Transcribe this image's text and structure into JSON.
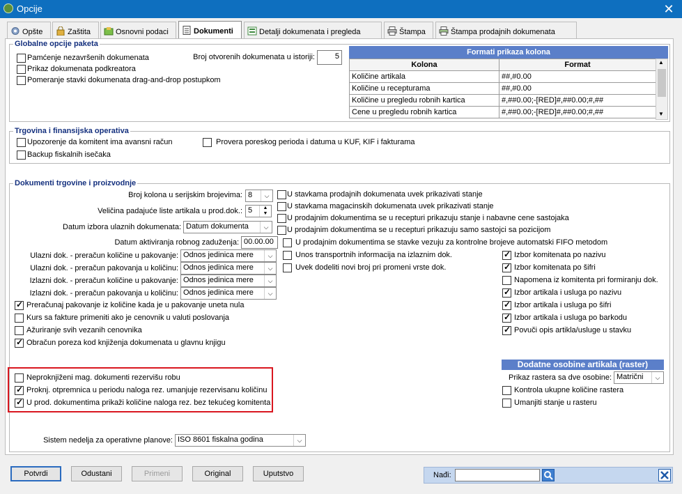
{
  "window": {
    "title": "Opcije",
    "close": "✕"
  },
  "tabs": [
    {
      "label": "Opšte"
    },
    {
      "label": "Zaštita"
    },
    {
      "label": "Osnovni podaci"
    },
    {
      "label": "Dokumenti"
    },
    {
      "label": "Detalji dokumenata i pregleda"
    },
    {
      "label": "Štampa"
    },
    {
      "label": "Štampa prodajnih dokumenata"
    }
  ],
  "global": {
    "title": "Globalne opcije paketa",
    "checks": [
      {
        "label": "Pamćenje nezavršenih dokumenata",
        "checked": false
      },
      {
        "label": "Prikaz dokumenata podkreatora",
        "checked": false
      },
      {
        "label": "Pomeranje stavki dokumenata drag-and-drop postupkom",
        "checked": false
      }
    ],
    "history_label": "Broj otvorenih dokumenata u istoriji:",
    "history_value": "5"
  },
  "formats": {
    "title": "Formati prikaza kolona",
    "headers": [
      "Kolona",
      "Format"
    ],
    "rows": [
      [
        "Količine artikala",
        "##,#0.00"
      ],
      [
        "Količine u recepturama",
        "##,#0.00"
      ],
      [
        "Količine u pregledu robnih kartica",
        "#,##0.00;-[RED]#,##0.00;#,##"
      ],
      [
        "Cene u pregledu robnih kartica",
        "#,##0.00;-[RED]#,##0.00;#,##"
      ]
    ]
  },
  "trade": {
    "title": "Trgovina i finansijska operativa",
    "checks": [
      {
        "label": "Upozorenje da komitent ima avansni račun",
        "checked": false
      },
      {
        "label": "Backup fiskalnih isečaka",
        "checked": false
      },
      {
        "label": "Provera poreskog perioda i datuma u KUF, KIF i fakturama",
        "checked": false
      }
    ]
  },
  "docs": {
    "title": "Dokumenti trgovine i proizvodnje",
    "serial_cols_label": "Broj kolona u serijskim brojevima:",
    "serial_cols_value": "8",
    "dropdown_size_label": "Veličina padajuće liste artikala u prod.dok.:",
    "dropdown_size_value": "5",
    "incoming_date_label": "Datum izbora ulaznih dokumenata:",
    "incoming_date_value": "Datum dokumenta",
    "activation_label": "Datum aktiviranja robnog zaduženja:",
    "activation_value": "00.00.00",
    "conversions": [
      {
        "label": "Ulazni dok. - preračun količine u pakovanje:",
        "value": "Odnos jedinica mere"
      },
      {
        "label": "Ulazni dok. - preračun pakovanja u količinu:",
        "value": "Odnos jedinica mere"
      },
      {
        "label": "Izlazni dok. - preračun količine u pakovanje:",
        "value": "Odnos jedinica mere"
      },
      {
        "label": "Izlazni dok. - preračun pakovanja u količinu:",
        "value": "Odnos jedinica mere"
      }
    ],
    "left_checks": [
      {
        "label": "Preračunaj pakovanje iz količine kada je u pakovanje uneta nula",
        "checked": true
      },
      {
        "label": "Kurs sa fakture primeniti ako je cenovnik u valuti poslovanja",
        "checked": false
      },
      {
        "label": "Ažuriranje svih vezanih cenovnika",
        "checked": false
      },
      {
        "label": "Obračun poreza kod knjiženja dokumenata u glavnu knjigu",
        "checked": true
      }
    ],
    "mid_checks": [
      {
        "label": "U stavkama prodajnih dokumenata uvek prikazivati stanje",
        "checked": false
      },
      {
        "label": "U stavkama magacinskih dokumenata uvek prikazivati stanje",
        "checked": false
      },
      {
        "label": "U prodajnim dokumentima se u recepturi prikazuju stanje i nabavne cene sastojaka",
        "checked": false
      },
      {
        "label": "U prodajnim dokumentima se u recepturi prikazuju samo sastojci sa pozicijom",
        "checked": false
      },
      {
        "label": "U prodajnim dokumentima se stavke vezuju za kontrolne brojeve automatski FIFO metodom",
        "checked": false
      },
      {
        "label": "Unos transportnih informacija na izlaznim dok.",
        "checked": false
      },
      {
        "label": "Uvek dodeliti novi broj pri promeni vrste dok.",
        "checked": false
      }
    ],
    "right_checks": [
      {
        "label": "Izbor komitenata po nazivu",
        "checked": true
      },
      {
        "label": "Izbor komitenata po šifri",
        "checked": true
      },
      {
        "label": "Napomena iz komitenta pri formiranju dok.",
        "checked": false
      },
      {
        "label": "Izbor artikala i usluga po nazivu",
        "checked": true
      },
      {
        "label": "Izbor artikala i usluga po šifri",
        "checked": true
      },
      {
        "label": "Izbor artikala i usluga po barkodu",
        "checked": true
      },
      {
        "label": "Povuči opis artikla/usluge u stavku",
        "checked": true
      }
    ],
    "reserve_checks": [
      {
        "label": "Neproknjiženi mag. dokumenti rezervišu robu",
        "checked": false
      },
      {
        "label": "Proknj. otpremnica u periodu naloga rez. umanjuje rezervisanu količinu",
        "checked": true
      },
      {
        "label": "U prod. dokumentima prikaži količine naloga rez. bez tekućeg komitenta",
        "checked": true
      }
    ],
    "raster": {
      "title": "Dodatne osobine artikala (raster)",
      "two_props_label": "Prikaz rastera sa dve osobine:",
      "two_props_value": "Matrični",
      "checks": [
        {
          "label": "Kontrola ukupne količine rastera",
          "checked": false
        },
        {
          "label": "Umanjiti stanje u rasteru",
          "checked": false
        }
      ]
    },
    "weeks_label": "Sistem nedelja za operativne planove:",
    "weeks_value": "ISO 8601 fiskalna godina"
  },
  "buttons": {
    "ok": "Potvrdi",
    "cancel": "Odustani",
    "apply": "Primeni",
    "original": "Original",
    "help": "Uputstvo"
  },
  "find": {
    "label": "Nađi:",
    "value": ""
  },
  "colors": {
    "title_bar": "#0e6fbf",
    "group_title": "#14307e",
    "header_blue": "#5b7fc9",
    "highlight_red": "#d9161f"
  }
}
